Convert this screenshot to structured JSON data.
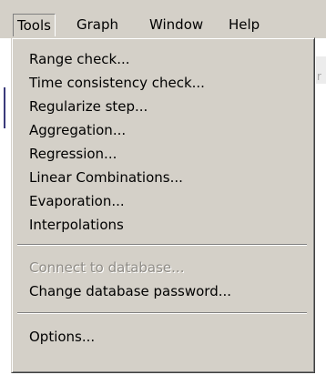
{
  "menubar": {
    "items": [
      {
        "label": "Tools"
      },
      {
        "label": "Graph"
      },
      {
        "label": "Window"
      },
      {
        "label": "Help"
      }
    ]
  },
  "dropdown": {
    "groups": [
      [
        "Range check...",
        "Time consistency check...",
        "Regularize step...",
        "Aggregation...",
        "Regression...",
        "Linear Combinations...",
        "Evaporation...",
        "Interpolations"
      ],
      [
        "Connect to database...",
        "Change database password..."
      ],
      [
        "Options..."
      ]
    ]
  },
  "background": {
    "partial_text": "r"
  }
}
